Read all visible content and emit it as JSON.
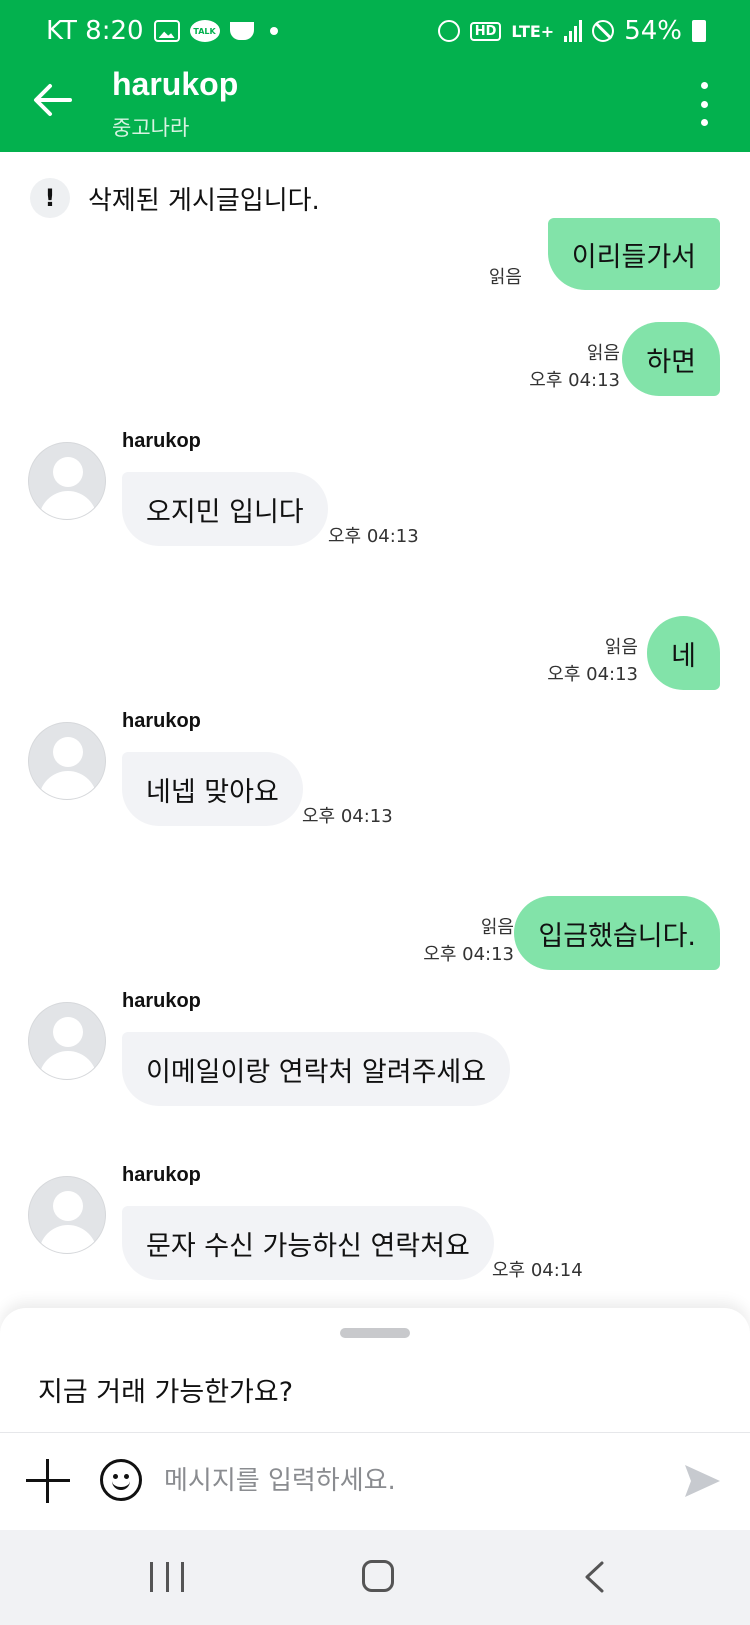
{
  "status_bar": {
    "carrier_time": "KT 8:20",
    "talk_label": "TALK",
    "hd": "HD",
    "network": "LTE+",
    "battery": "54%"
  },
  "header": {
    "title": "harukop",
    "subtitle": "중고나라",
    "accent_color": "#03b14e"
  },
  "chat": {
    "notice": "삭제된 게시글입니다.",
    "messages": [
      {
        "dir": "out",
        "text": "이리들가서",
        "read": "읽음",
        "time": ""
      },
      {
        "dir": "out",
        "text": "하면",
        "read": "읽음",
        "time": "오후 04:13"
      },
      {
        "dir": "in",
        "sender": "harukop",
        "text": "오지민 입니다",
        "time": "오후 04:13"
      },
      {
        "dir": "out",
        "text": "네",
        "read": "읽음",
        "time": "오후 04:13"
      },
      {
        "dir": "in",
        "sender": "harukop",
        "text": "네넵 맞아요",
        "time": "오후 04:13"
      },
      {
        "dir": "out",
        "text": "입금했습니다.",
        "read": "읽음",
        "time": "오후 04:13"
      },
      {
        "dir": "in",
        "sender": "harukop",
        "text": "이메일이랑 연락처 알려주세요",
        "time": ""
      },
      {
        "dir": "in",
        "sender": "harukop",
        "text": "문자 수신 가능하신 연락처요",
        "time": "오후 04:14"
      }
    ]
  },
  "sheet": {
    "quick_reply": "지금 거래 가능한가요?"
  },
  "input": {
    "placeholder": "메시지를 입력하세요."
  }
}
